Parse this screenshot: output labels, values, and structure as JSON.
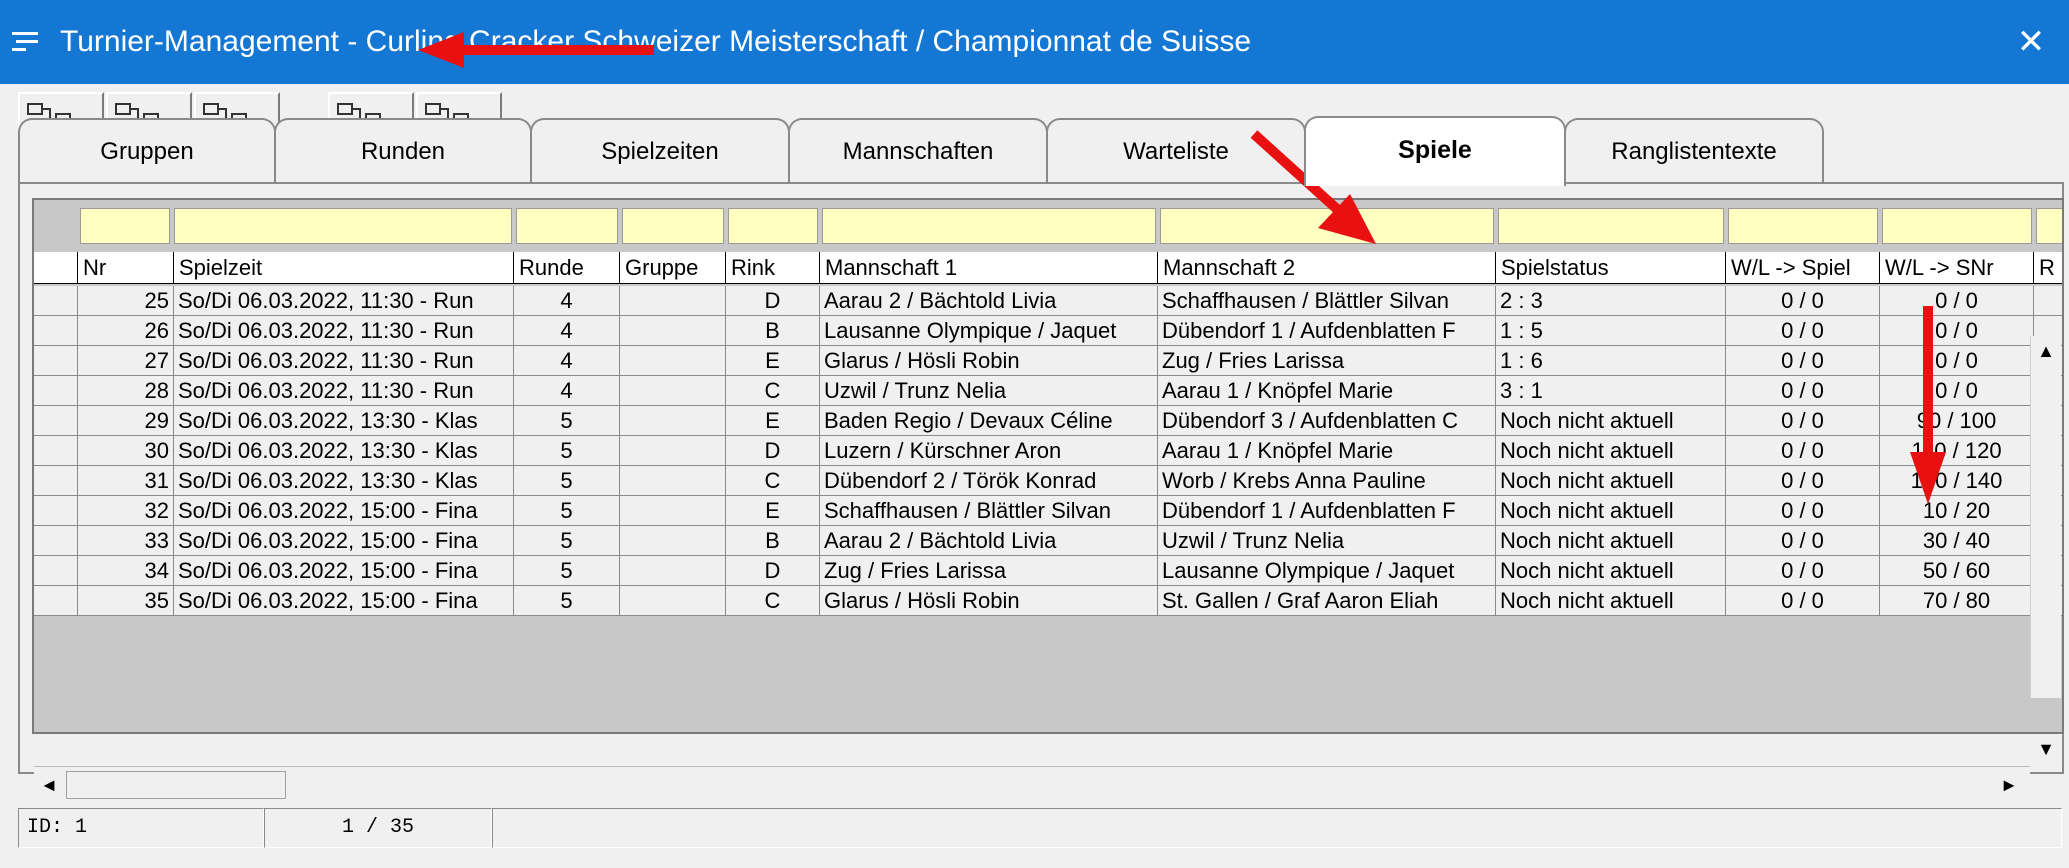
{
  "window": {
    "title": "Turnier-Management - Curling Cracker Schweizer Meisterschaft / Championnat de Suisse",
    "close_symbol": "✕"
  },
  "toolbar": {
    "buttons": [
      {
        "icon": "add-item-icon",
        "accent": "#2eb82e"
      },
      {
        "icon": "edit-item-icon",
        "accent": "#f2b600"
      },
      {
        "icon": "delete-item-icon",
        "accent": "#e02020"
      },
      {
        "icon": "generate-item-icon",
        "accent": "#f2b600"
      },
      {
        "icon": "reset-item-icon",
        "accent": "#e02020"
      }
    ]
  },
  "tabs": [
    {
      "label": "Gruppen",
      "active": false
    },
    {
      "label": "Runden",
      "active": false
    },
    {
      "label": "Spielzeiten",
      "active": false
    },
    {
      "label": "Mannschaften",
      "active": false
    },
    {
      "label": "Warteliste",
      "active": false
    },
    {
      "label": "Spiele",
      "active": true
    },
    {
      "label": "Ranglistentexte",
      "active": false
    }
  ],
  "grid": {
    "columns": [
      "Nr",
      "Spielzeit",
      "Runde",
      "Gruppe",
      "Rink",
      "Mannschaft 1",
      "Mannschaft 2",
      "Spielstatus",
      "W/L -> Spiel",
      "W/L -> SNr",
      "R"
    ],
    "rows": [
      [
        "25",
        "So/Di 06.03.2022, 11:30 - Run",
        "4",
        "",
        "D",
        "Aarau 2 / Bächtold Livia",
        "Schaffhausen / Blättler Silvan",
        "2 : 3",
        "0 / 0",
        "0 / 0"
      ],
      [
        "26",
        "So/Di 06.03.2022, 11:30 - Run",
        "4",
        "",
        "B",
        "Lausanne Olympique / Jaquet",
        "Dübendorf 1 / Aufdenblatten F",
        "1 : 5",
        "0 / 0",
        "0 / 0"
      ],
      [
        "27",
        "So/Di 06.03.2022, 11:30 - Run",
        "4",
        "",
        "E",
        "Glarus / Hösli Robin",
        "Zug / Fries Larissa",
        "1 : 6",
        "0 / 0",
        "0 / 0"
      ],
      [
        "28",
        "So/Di 06.03.2022, 11:30 - Run",
        "4",
        "",
        "C",
        "Uzwil / Trunz Nelia",
        "Aarau 1 / Knöpfel Marie",
        "3 : 1",
        "0 / 0",
        "0 / 0"
      ],
      [
        "29",
        "So/Di 06.03.2022, 13:30 - Klas",
        "5",
        "",
        "E",
        "Baden Regio / Devaux Céline",
        "Dübendorf 3 / Aufdenblatten C",
        "Noch nicht aktuell",
        "0 / 0",
        "90 / 100"
      ],
      [
        "30",
        "So/Di 06.03.2022, 13:30 - Klas",
        "5",
        "",
        "D",
        "Luzern / Kürschner Aron",
        "Aarau 1 / Knöpfel Marie",
        "Noch nicht aktuell",
        "0 / 0",
        "110 / 120"
      ],
      [
        "31",
        "So/Di 06.03.2022, 13:30 - Klas",
        "5",
        "",
        "C",
        "Dübendorf 2 / Török Konrad",
        "Worb / Krebs Anna Pauline",
        "Noch nicht aktuell",
        "0 / 0",
        "130 / 140"
      ],
      [
        "32",
        "So/Di 06.03.2022, 15:00 - Fina",
        "5",
        "",
        "E",
        "Schaffhausen / Blättler Silvan",
        "Dübendorf 1 / Aufdenblatten F",
        "Noch nicht aktuell",
        "0 / 0",
        "10 / 20"
      ],
      [
        "33",
        "So/Di 06.03.2022, 15:00 - Fina",
        "5",
        "",
        "B",
        "Aarau 2 / Bächtold Livia",
        "Uzwil / Trunz Nelia",
        "Noch nicht aktuell",
        "0 / 0",
        "30 / 40"
      ],
      [
        "34",
        "So/Di 06.03.2022, 15:00 - Fina",
        "5",
        "",
        "D",
        "Zug / Fries Larissa",
        "Lausanne Olympique / Jaquet",
        "Noch nicht aktuell",
        "0 / 0",
        "50 / 60"
      ],
      [
        "35",
        "So/Di 06.03.2022, 15:00 - Fina",
        "5",
        "",
        "C",
        "Glarus / Hösli Robin",
        "St. Gallen / Graf Aaron Eliah",
        "Noch nicht aktuell",
        "0 / 0",
        "70 / 80"
      ]
    ]
  },
  "statusbar": {
    "id": "ID: 1",
    "position": "1 / 35"
  },
  "scroll": {
    "up": "▲",
    "down": "▼",
    "left": "◄",
    "right": "►"
  },
  "colors": {
    "title_bar": "#1477d4",
    "filter_cell": "#ffffc2",
    "annotation_arrow": "#e81010"
  }
}
